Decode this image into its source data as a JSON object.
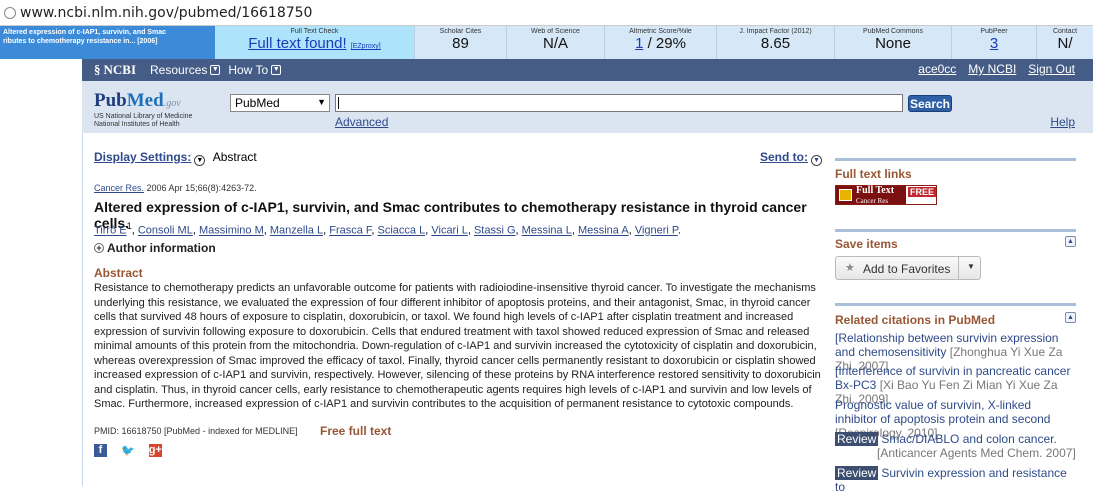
{
  "browser": {
    "url": "www.ncbi.nlm.nih.gov/pubmed/16618750"
  },
  "plugin": {
    "article_line1": "Altered expression of c-IAP1, survivin, and Smac",
    "article_line2": "ributes to chemotherapy resistance in... [2006]",
    "fulltext": {
      "label": "Full Text Check",
      "value": "Full text found!",
      "ezproxy": "[EZproxy]"
    },
    "cells": [
      {
        "label": "Scholar Cites",
        "value": "89",
        "link": false
      },
      {
        "label": "Web of Science",
        "value": "N/A",
        "link": false
      },
      {
        "label": "Altmetric Score/%ile",
        "value": "1",
        "suffix": " / 29%",
        "link": true
      },
      {
        "label": "J. Impact Factor (2012)",
        "value": "8.65",
        "link": false
      },
      {
        "label": "PubMed Commons",
        "value": "None",
        "link": false
      },
      {
        "label": "PubPeer",
        "value": "3",
        "link": true
      },
      {
        "label": "Contact",
        "value": "N/",
        "link": false
      }
    ]
  },
  "ncbi": {
    "logo": "NCBI",
    "resources": "Resources",
    "howto": "How To",
    "user": "ace0cc",
    "myncbi": "My NCBI",
    "signout": "Sign Out"
  },
  "search": {
    "logo_pub": "Pub",
    "logo_med": "Med",
    "logo_gov": ".gov",
    "sub1": "US National Library of Medicine",
    "sub2": "National Institutes of Health",
    "db": "PubMed",
    "query": "",
    "button": "Search",
    "advanced": "Advanced",
    "help": "Help"
  },
  "article": {
    "display_settings": "Display Settings:",
    "display_value": "Abstract",
    "send_to": "Send to:",
    "journal": "Cancer Res.",
    "citation_rest": " 2006 Apr 15;66(8):4263-72.",
    "title": "Altered expression of c-IAP1, survivin, and Smac contributes to chemotherapy resistance in thyroid cancer cells.",
    "authors": [
      "Tirrò E",
      "Consoli ML",
      "Massimino M",
      "Manzella L",
      "Frasca F",
      "Sciacca L",
      "Vicari L",
      "Stassi G",
      "Messina L",
      "Messina A",
      "Vigneri P"
    ],
    "first_author_sup": "1",
    "author_info": "Author information",
    "abstract_heading": "Abstract",
    "abstract": "Resistance to chemotherapy predicts an unfavorable outcome for patients with radioiodine-insensitive thyroid cancer. To investigate the mechanisms underlying this resistance, we evaluated the expression of four different inhibitor of apoptosis proteins, and their antagonist, Smac, in thyroid cancer cells that survived 48 hours of exposure to cisplatin, doxorubicin, or taxol. We found high levels of c-IAP1 after cisplatin treatment and increased expression of survivin following exposure to doxorubicin. Cells that endured treatment with taxol showed reduced expression of Smac and released minimal amounts of this protein from the mitochondria. Down-regulation of c-IAP1 and survivin increased the cytotoxicity of cisplatin and doxorubicin, whereas overexpression of Smac improved the efficacy of taxol. Finally, thyroid cancer cells permanently resistant to doxorubicin or cisplatin showed increased expression of c-IAP1 and survivin, respectively. However, silencing of these proteins by RNA interference restored sensitivity to doxorubicin and cisplatin. Thus, in thyroid cancer cells, early resistance to chemotherapeutic agents requires high levels of c-IAP1 and survivin and low levels of Smac. Furthermore, increased expression of c-IAP1 and survivin contributes to the acquisition of permanent resistance to cytotoxic compounds.",
    "pmid": "PMID: 16618750 [PubMed - indexed for MEDLINE]",
    "free_full_text": "Free full text",
    "social": {
      "fb": "f",
      "tw": "🐦",
      "gp": "g+"
    }
  },
  "sidebar": {
    "fulltext_links": "Full text links",
    "badge_title": "Full Text",
    "badge_sub": "Cancer Res",
    "badge_free": "FREE",
    "save_items": "Save items",
    "add_fav": "Add to Favorites",
    "related_heading": "Related citations in PubMed",
    "related": [
      {
        "review": "",
        "title": "[Relationship between survivin expression and chemosensitivity",
        "source": "[Zhonghua Yi Xue Za Zhi. 2007]"
      },
      {
        "review": "",
        "title": "[Interference of survivin in pancreatic cancer Bx-PC3",
        "source": "[Xi Bao Yu Fen Zi Mian Yi Xue Za Zhi. 2009]"
      },
      {
        "review": "",
        "title": "Prognostic value of survivin, X-linked inhibitor of apoptosis protein and second",
        "source": "[Respirology. 2010]"
      },
      {
        "review": "Review",
        "title": "Smac/DIABLO and colon cancer.",
        "source": "[Anticancer Agents Med Chem. 2007]"
      },
      {
        "review": "Review",
        "title": "Survivin expression and resistance to",
        "source": ""
      }
    ]
  }
}
